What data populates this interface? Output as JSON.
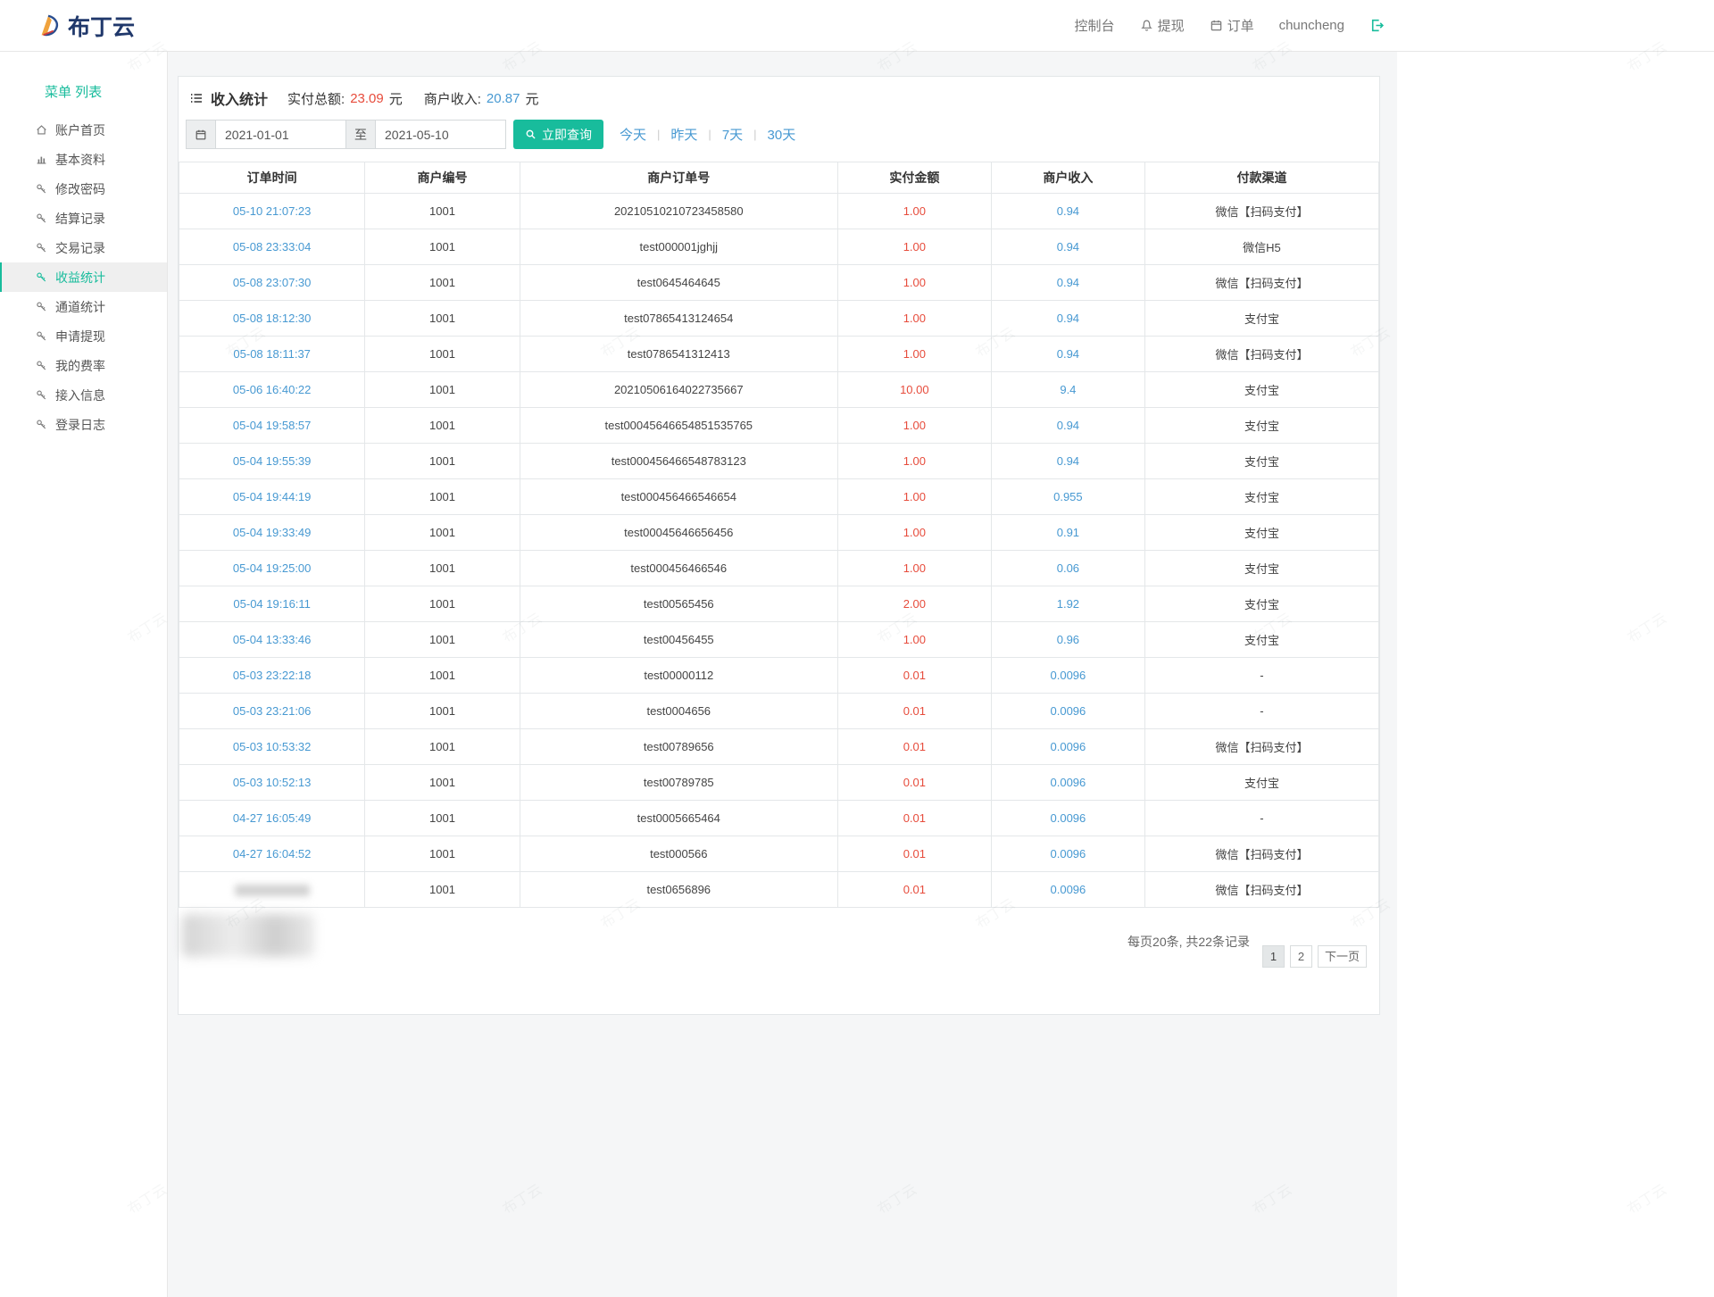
{
  "colors": {
    "accent": "#18bc9c",
    "link": "#4799d2",
    "red": "#e74c3c"
  },
  "brand": {
    "name": "布丁云"
  },
  "navbar": {
    "console": "控制台",
    "withdraw": "提现",
    "orders": "订单",
    "username": "chuncheng"
  },
  "sidebar": {
    "title": "菜单 列表",
    "items": [
      {
        "label": "账户首页",
        "icon": "home",
        "active": false
      },
      {
        "label": "基本资料",
        "icon": "chart",
        "active": false
      },
      {
        "label": "修改密码",
        "icon": "key",
        "active": false
      },
      {
        "label": "结算记录",
        "icon": "key",
        "active": false
      },
      {
        "label": "交易记录",
        "icon": "key",
        "active": false
      },
      {
        "label": "收益统计",
        "icon": "key",
        "active": true
      },
      {
        "label": "通道统计",
        "icon": "key",
        "active": false
      },
      {
        "label": "申请提现",
        "icon": "key",
        "active": false
      },
      {
        "label": "我的费率",
        "icon": "key",
        "active": false
      },
      {
        "label": "接入信息",
        "icon": "key",
        "active": false
      },
      {
        "label": "登录日志",
        "icon": "key",
        "active": false
      }
    ]
  },
  "main": {
    "title": "收入统计",
    "stats": [
      {
        "label": "实付总额:",
        "value": "23.09",
        "unit": "元"
      },
      {
        "label": "商户收入:",
        "value": "20.87",
        "unit": "元"
      }
    ],
    "filter": {
      "date_from": "2021-01-01",
      "to_label": "至",
      "date_to": "2021-05-10",
      "search_label": "立即查询",
      "quick_links": [
        "今天",
        "昨天",
        "7天",
        "30天"
      ]
    },
    "table": {
      "headers": [
        "订单时间",
        "商户编号",
        "商户订单号",
        "实付金额",
        "商户收入",
        "付款渠道"
      ],
      "rows": [
        {
          "time": "05-10 21:07:23",
          "merchant_no": "1001",
          "order_no": "20210510210723458580",
          "amount": "1.00",
          "income": "0.94",
          "channel": "微信【扫码支付】"
        },
        {
          "time": "05-08 23:33:04",
          "merchant_no": "1001",
          "order_no": "test000001jghjj",
          "amount": "1.00",
          "income": "0.94",
          "channel": "微信H5"
        },
        {
          "time": "05-08 23:07:30",
          "merchant_no": "1001",
          "order_no": "test0645464645",
          "amount": "1.00",
          "income": "0.94",
          "channel": "微信【扫码支付】"
        },
        {
          "time": "05-08 18:12:30",
          "merchant_no": "1001",
          "order_no": "test07865413124654",
          "amount": "1.00",
          "income": "0.94",
          "channel": "支付宝"
        },
        {
          "time": "05-08 18:11:37",
          "merchant_no": "1001",
          "order_no": "test0786541312413",
          "amount": "1.00",
          "income": "0.94",
          "channel": "微信【扫码支付】"
        },
        {
          "time": "05-06 16:40:22",
          "merchant_no": "1001",
          "order_no": "20210506164022735667",
          "amount": "10.00",
          "income": "9.4",
          "channel": "支付宝"
        },
        {
          "time": "05-04 19:58:57",
          "merchant_no": "1001",
          "order_no": "test00045646654851535765",
          "amount": "1.00",
          "income": "0.94",
          "channel": "支付宝"
        },
        {
          "time": "05-04 19:55:39",
          "merchant_no": "1001",
          "order_no": "test000456466548783123",
          "amount": "1.00",
          "income": "0.94",
          "channel": "支付宝"
        },
        {
          "time": "05-04 19:44:19",
          "merchant_no": "1001",
          "order_no": "test000456466546654",
          "amount": "1.00",
          "income": "0.955",
          "channel": "支付宝"
        },
        {
          "time": "05-04 19:33:49",
          "merchant_no": "1001",
          "order_no": "test00045646656456",
          "amount": "1.00",
          "income": "0.91",
          "channel": "支付宝"
        },
        {
          "time": "05-04 19:25:00",
          "merchant_no": "1001",
          "order_no": "test000456466546",
          "amount": "1.00",
          "income": "0.06",
          "channel": "支付宝"
        },
        {
          "time": "05-04 19:16:11",
          "merchant_no": "1001",
          "order_no": "test00565456",
          "amount": "2.00",
          "income": "1.92",
          "channel": "支付宝"
        },
        {
          "time": "05-04 13:33:46",
          "merchant_no": "1001",
          "order_no": "test00456455",
          "amount": "1.00",
          "income": "0.96",
          "channel": "支付宝"
        },
        {
          "time": "05-03 23:22:18",
          "merchant_no": "1001",
          "order_no": "test00000112",
          "amount": "0.01",
          "income": "0.0096",
          "channel": "-"
        },
        {
          "time": "05-03 23:21:06",
          "merchant_no": "1001",
          "order_no": "test0004656",
          "amount": "0.01",
          "income": "0.0096",
          "channel": "-"
        },
        {
          "time": "05-03 10:53:32",
          "merchant_no": "1001",
          "order_no": "test00789656",
          "amount": "0.01",
          "income": "0.0096",
          "channel": "微信【扫码支付】"
        },
        {
          "time": "05-03 10:52:13",
          "merchant_no": "1001",
          "order_no": "test00789785",
          "amount": "0.01",
          "income": "0.0096",
          "channel": "支付宝"
        },
        {
          "time": "04-27 16:05:49",
          "merchant_no": "1001",
          "order_no": "test0005665464",
          "amount": "0.01",
          "income": "0.0096",
          "channel": "-"
        },
        {
          "time": "04-27 16:04:52",
          "merchant_no": "1001",
          "order_no": "test000566",
          "amount": "0.01",
          "income": "0.0096",
          "channel": "微信【扫码支付】"
        },
        {
          "time": "",
          "merchant_no": "1001",
          "order_no": "test0656896",
          "amount": "0.01",
          "income": "0.0096",
          "channel": "微信【扫码支付】"
        }
      ]
    },
    "pagination": {
      "summary": "每页20条, 共22条记录",
      "pages": [
        "1",
        "2"
      ],
      "active": "1",
      "next_label": "下一页"
    }
  },
  "watermark": {
    "text": "布丁云"
  }
}
